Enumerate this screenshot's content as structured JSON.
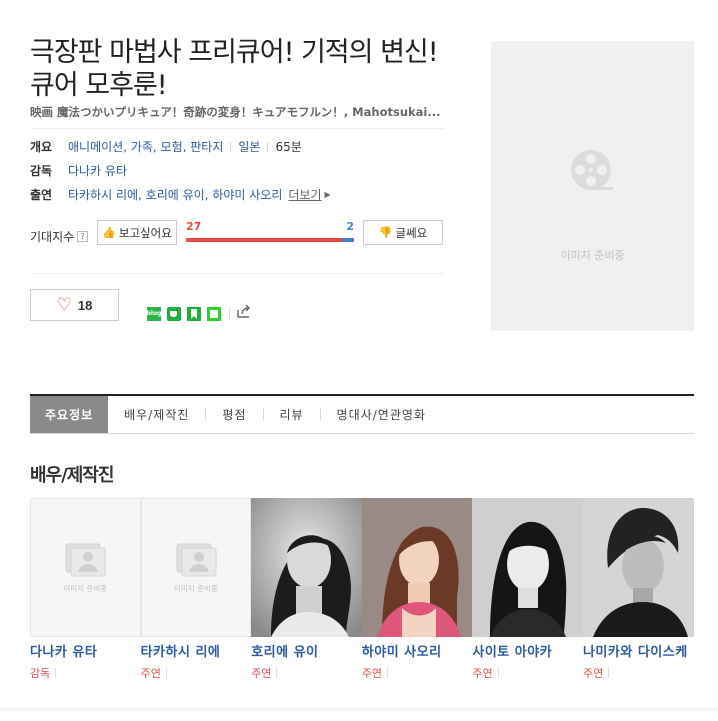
{
  "movie": {
    "title": "극장판 마법사 프리큐어! 기적의 변신! 큐어 모후룬!",
    "subtitle": "映画 魔法つかいプリキュア！奇跡の変身！キュアモフルン！, Mahotsukai..."
  },
  "info": {
    "overview_label": "개요",
    "genres": "애니메이션, 가족, 모험, 판타지",
    "country": "일본",
    "runtime": "65분",
    "director_label": "감독",
    "director": "다나카 유타",
    "cast_label": "출연",
    "cast_names": "타카하시 리에, 호리에 유이, 하야미 사오리",
    "more_label": "더보기"
  },
  "anticipation": {
    "label": "기대지수",
    "help_icon": "?",
    "want_label": "보고싶어요",
    "meh_label": "글쎄요",
    "want_count": 27,
    "meh_count": 2
  },
  "like": {
    "count": "18"
  },
  "share_icons": [
    "blog-icon",
    "cafe-icon",
    "bookmark-icon",
    "band-icon",
    "share-icon"
  ],
  "poster": {
    "placeholder": "이미지 준비중"
  },
  "tabs": [
    "주요정보",
    "배우/제작진",
    "평점",
    "리뷰",
    "명대사/연관영화"
  ],
  "cast_section": {
    "title": "배우/제작진",
    "placeholder_text": "이미지 준비중",
    "people": [
      {
        "name": "다나카 유타",
        "role": "감독",
        "has_photo": false
      },
      {
        "name": "타카하시 리에",
        "role": "주연",
        "has_photo": false
      },
      {
        "name": "호리에 유이",
        "role": "주연",
        "has_photo": true
      },
      {
        "name": "하야미 사오리",
        "role": "주연",
        "has_photo": true
      },
      {
        "name": "사이토 아야카",
        "role": "주연",
        "has_photo": true
      },
      {
        "name": "나미카와 다이스케",
        "role": "주연",
        "has_photo": true
      }
    ]
  },
  "colors": {
    "link": "#2c5aa0",
    "accent_red": "#e84a48",
    "accent_blue": "#4a7ed9",
    "role_red": "#d9534f"
  }
}
